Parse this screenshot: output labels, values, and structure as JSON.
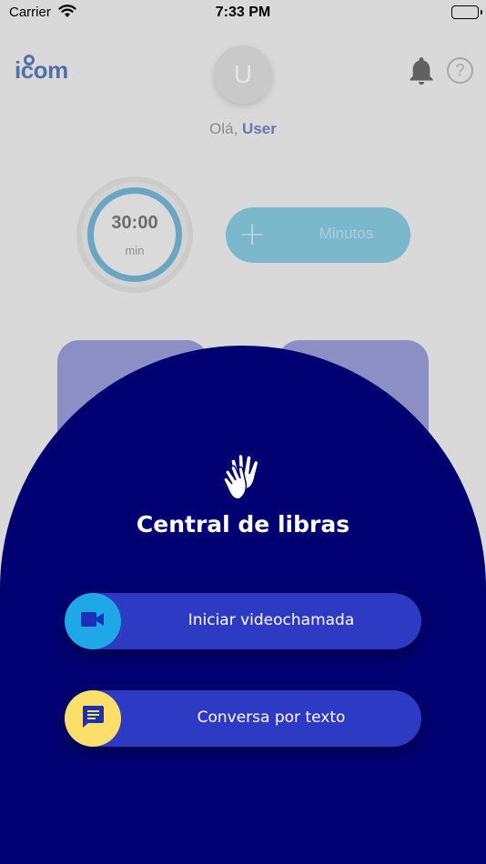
{
  "status_bar": {
    "carrier": "Carrier",
    "time": "7:33 PM",
    "icons": [
      "wifi-icon",
      "battery-icon"
    ]
  },
  "header": {
    "logo_text": "icom",
    "avatar_initial": "U",
    "greeting_prefix": "Olá,",
    "user_name": "User",
    "icons": [
      "bell-icon",
      "help-icon"
    ]
  },
  "timer": {
    "value": "30:00",
    "unit": "min",
    "ring_color": "#6aa6c2"
  },
  "minutes_button": {
    "label": "Minutos",
    "icon": "plus-icon"
  },
  "sheet": {
    "icon": "sign-language-hands-icon",
    "title": "Central de libras",
    "background_color": "#000072",
    "actions": [
      {
        "label": "Iniciar videochamada",
        "icon": "video-camera-icon",
        "icon_color": "#1fa7e6"
      },
      {
        "label": "Conversa por texto",
        "icon": "chat-message-icon",
        "icon_color": "#fadf6b"
      }
    ],
    "action_color": "#2d3ac4"
  }
}
